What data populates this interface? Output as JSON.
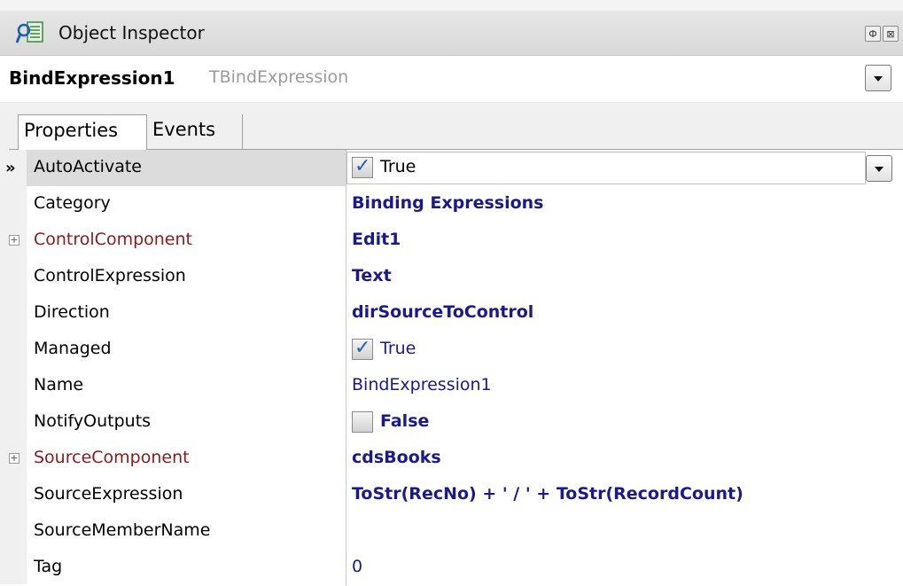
{
  "window": {
    "title": "Object Inspector",
    "pin_label": "Ф",
    "close_label": "⊠"
  },
  "selector": {
    "name": "BindExpression1",
    "type": "TBindExpression"
  },
  "tabs": [
    {
      "label": "Properties"
    },
    {
      "label": "Events"
    }
  ],
  "rows": [
    {
      "name": "AutoActivate",
      "value": "True"
    },
    {
      "name": "Category",
      "value": "Binding Expressions"
    },
    {
      "name": "ControlComponent",
      "value": "Edit1"
    },
    {
      "name": "ControlExpression",
      "value": "Text"
    },
    {
      "name": "Direction",
      "value": "dirSourceToControl"
    },
    {
      "name": "Managed",
      "value": "True"
    },
    {
      "name": "Name",
      "value": "BindExpression1"
    },
    {
      "name": "NotifyOutputs",
      "value": "False"
    },
    {
      "name": "SourceComponent",
      "value": "cdsBooks"
    },
    {
      "name": "SourceExpression",
      "value": "ToStr(RecNo) + ' / ' + ToStr(RecordCount)"
    },
    {
      "name": "SourceMemberName",
      "value": ""
    },
    {
      "name": "Tag",
      "value": "0"
    }
  ],
  "colors": {
    "value_text": "#1a1a8c",
    "reference_property": "#8b1a1a",
    "checkbox_tick": "#2a5bb4"
  }
}
